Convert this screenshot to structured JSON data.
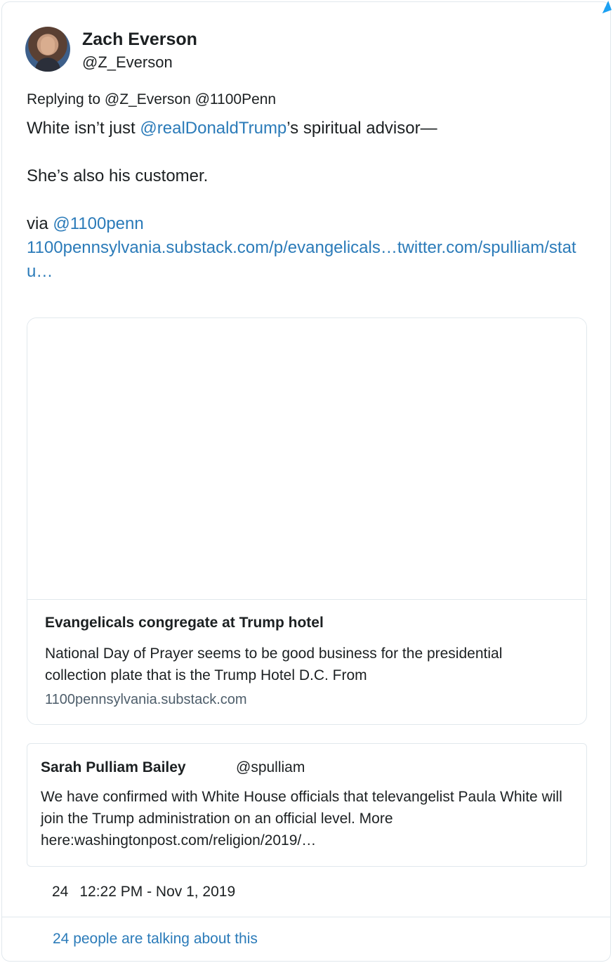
{
  "author": {
    "display_name": "Zach Everson",
    "screen_name": "@Z_Everson"
  },
  "reply": {
    "label": "Replying to @Z_Everson @1100Penn"
  },
  "tweet": {
    "line1_prefix": "White isn’t just ",
    "line1_mention": "@realDonaldTrump",
    "line1_suffix": "’s spiritual advisor—",
    "line2": "She’s also his customer.",
    "line3_prefix": "via ",
    "line3_mention": "@1100penn",
    "line4_links": "1100pennsylvania.substack.com/p/evangelicals…twitter.com/spulliam/statu…"
  },
  "link_card": {
    "title": "Evangelicals congregate at Trump hotel",
    "description": "National Day of Prayer seems to be good business for the presidential collection plate that is the Trump Hotel D.C. From",
    "domain": "1100pennsylvania.substack.com"
  },
  "quoted_tweet": {
    "name": "Sarah Pulliam Bailey",
    "handle": "@spulliam",
    "text": "We have confirmed with White House officials that televangelist Paula White will join the Trump administration on an official level. More here:washingtonpost.com/religion/2019/…"
  },
  "meta": {
    "likes": "24",
    "timestamp": "12:22 PM - Nov 1, 2019"
  },
  "footer": {
    "talking": "24 people are talking about this"
  },
  "colors": {
    "link": "#2b7bb9",
    "border": "#e1e8ed",
    "text": "#1c2022",
    "accent": "#1da1f2"
  }
}
